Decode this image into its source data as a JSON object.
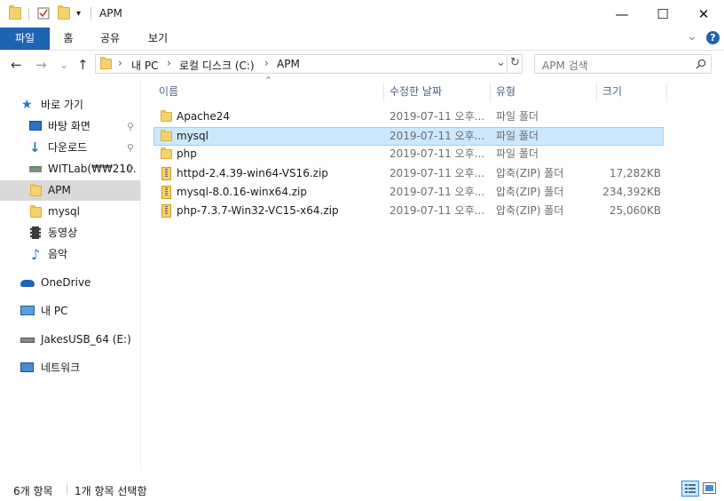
{
  "window": {
    "title": "APM",
    "minimize": "—",
    "maximize": "☐",
    "close": "✕"
  },
  "ribbon": {
    "tabs": [
      "파일",
      "홈",
      "공유",
      "보기"
    ],
    "expand_glyph": "⌄",
    "help_glyph": "?"
  },
  "nav": {
    "back": "←",
    "forward": "→",
    "recent": "⌄",
    "up": "↑",
    "breadcrumb": [
      "내 PC",
      "로컬 디스크 (C:)",
      "APM"
    ],
    "separator": "›",
    "refresh": "↻",
    "dropdown": "⌄",
    "search_placeholder": "APM 검색"
  },
  "sidebar": {
    "items": [
      {
        "label": "바로 가기",
        "icon": "star-icon",
        "pinned": false
      },
      {
        "label": "바탕 화면",
        "icon": "desktop-icon",
        "pinned": true
      },
      {
        "label": "다운로드",
        "icon": "download-icon",
        "pinned": true
      },
      {
        "label": "WITLab(₩₩210.",
        "icon": "network-drive-icon",
        "pinned": true
      },
      {
        "label": "APM",
        "icon": "folder-icon",
        "pinned": false,
        "selected": true
      },
      {
        "label": "mysql",
        "icon": "folder-icon",
        "pinned": false
      },
      {
        "label": "동영상",
        "icon": "video-icon",
        "pinned": false
      },
      {
        "label": "음악",
        "icon": "music-icon",
        "pinned": false
      },
      {
        "label": "OneDrive",
        "icon": "cloud-icon",
        "pinned": false
      },
      {
        "label": "내 PC",
        "icon": "pc-icon",
        "pinned": false
      },
      {
        "label": "JakesUSB_64 (E:)",
        "icon": "usb-drive-icon",
        "pinned": false
      },
      {
        "label": "네트워크",
        "icon": "network-icon",
        "pinned": false
      }
    ]
  },
  "list": {
    "columns": [
      "이름",
      "수정한 날짜",
      "유형",
      "크기"
    ],
    "sort_glyph": "⌃",
    "rows": [
      {
        "name": "Apache24",
        "date": "2019-07-11 오후...",
        "type": "파일 폴더",
        "size": "",
        "icon": "folder-icon"
      },
      {
        "name": "mysql",
        "date": "2019-07-11 오후...",
        "type": "파일 폴더",
        "size": "",
        "icon": "folder-icon",
        "selected": true
      },
      {
        "name": "php",
        "date": "2019-07-11 오후...",
        "type": "파일 폴더",
        "size": "",
        "icon": "folder-icon"
      },
      {
        "name": "httpd-2.4.39-win64-VS16.zip",
        "date": "2019-07-11 오후...",
        "type": "압축(ZIP) 폴더",
        "size": "17,282KB",
        "icon": "zip-icon"
      },
      {
        "name": "mysql-8.0.16-winx64.zip",
        "date": "2019-07-11 오후...",
        "type": "압축(ZIP) 폴더",
        "size": "234,392KB",
        "icon": "zip-icon"
      },
      {
        "name": "php-7.3.7-Win32-VC15-x64.zip",
        "date": "2019-07-11 오후...",
        "type": "압축(ZIP) 폴더",
        "size": "25,060KB",
        "icon": "zip-icon"
      }
    ]
  },
  "status": {
    "item_count": "6개 항목",
    "selection": "1개 항목 선택함"
  },
  "colors": {
    "file_tab": "#1e64b4",
    "selection": "#cce8ff",
    "selection_border": "#99d1ff",
    "sidebar_selected": "#d9d9d9",
    "folder": "#f6d26b"
  }
}
